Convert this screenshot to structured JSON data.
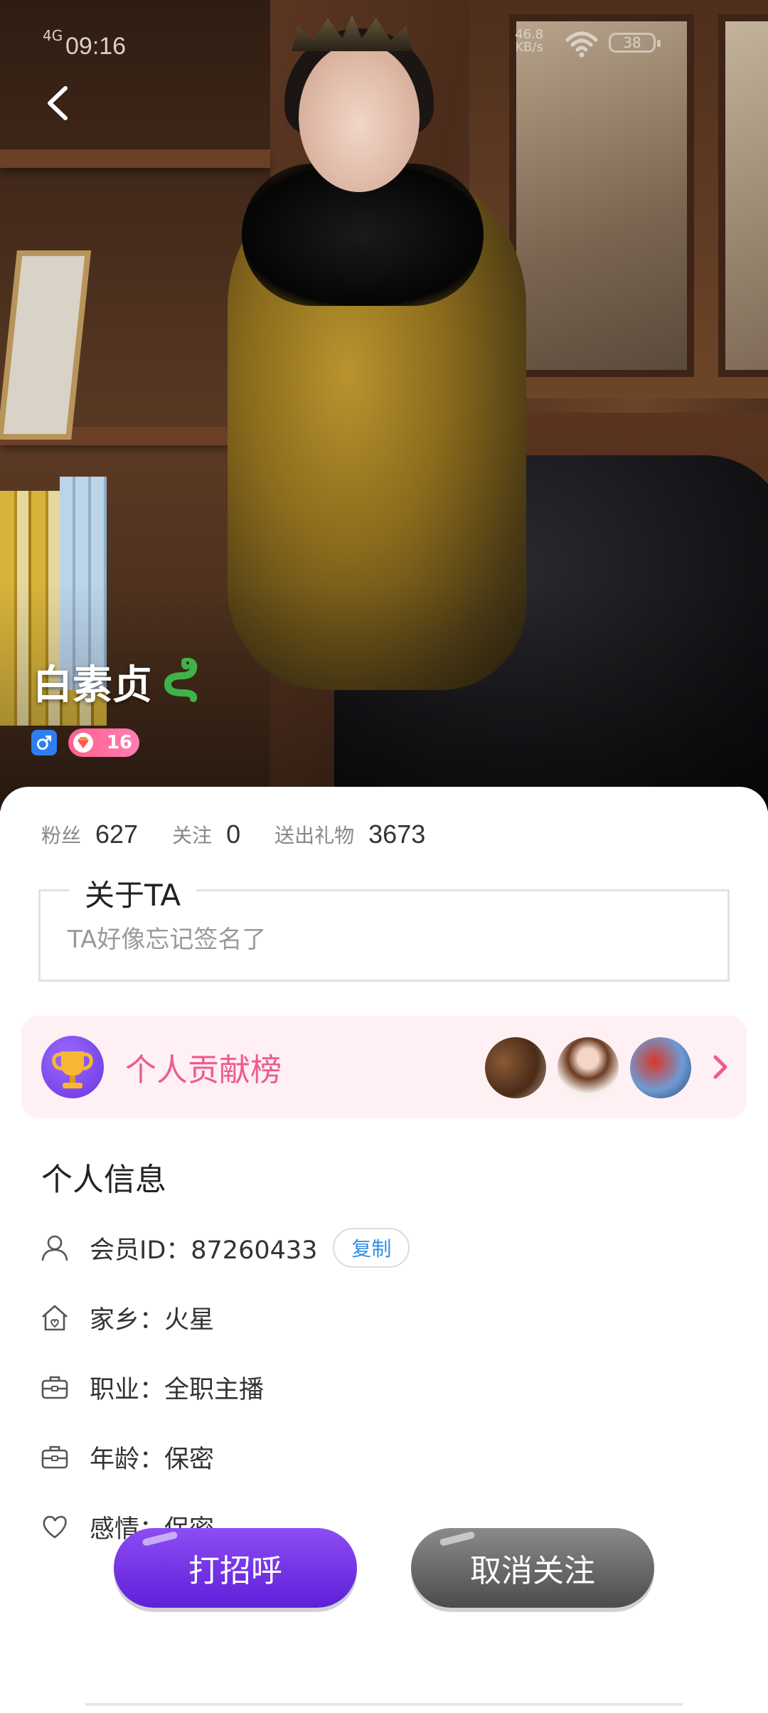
{
  "status_bar": {
    "network": "4G",
    "time": "09:16",
    "speed": "46.8",
    "speed_unit": "KB/s",
    "battery": "38"
  },
  "profile": {
    "name": "白素贞",
    "level": "16",
    "stats": [
      {
        "label": "粉丝",
        "value": "627"
      },
      {
        "label": "关注",
        "value": "0"
      },
      {
        "label": "送出礼物",
        "value": "3673"
      }
    ]
  },
  "about": {
    "title": "关于TA",
    "signature": "TA好像忘记签名了"
  },
  "ranking": {
    "label": "个人贡献榜"
  },
  "info": {
    "title": "个人信息",
    "member_id": "会员ID：87260433",
    "copy_label": "复制",
    "hometown": "家乡：火星",
    "job": "职业：全职主播",
    "age": "年龄：保密",
    "relationship": "感情：保密"
  },
  "actions": {
    "greet": "打招呼",
    "unfollow": "取消关注"
  },
  "colors": {
    "accent_pink": "#ef5b8c",
    "greet_purple": "#6a2be0",
    "copy_blue": "#2f8fe6"
  }
}
